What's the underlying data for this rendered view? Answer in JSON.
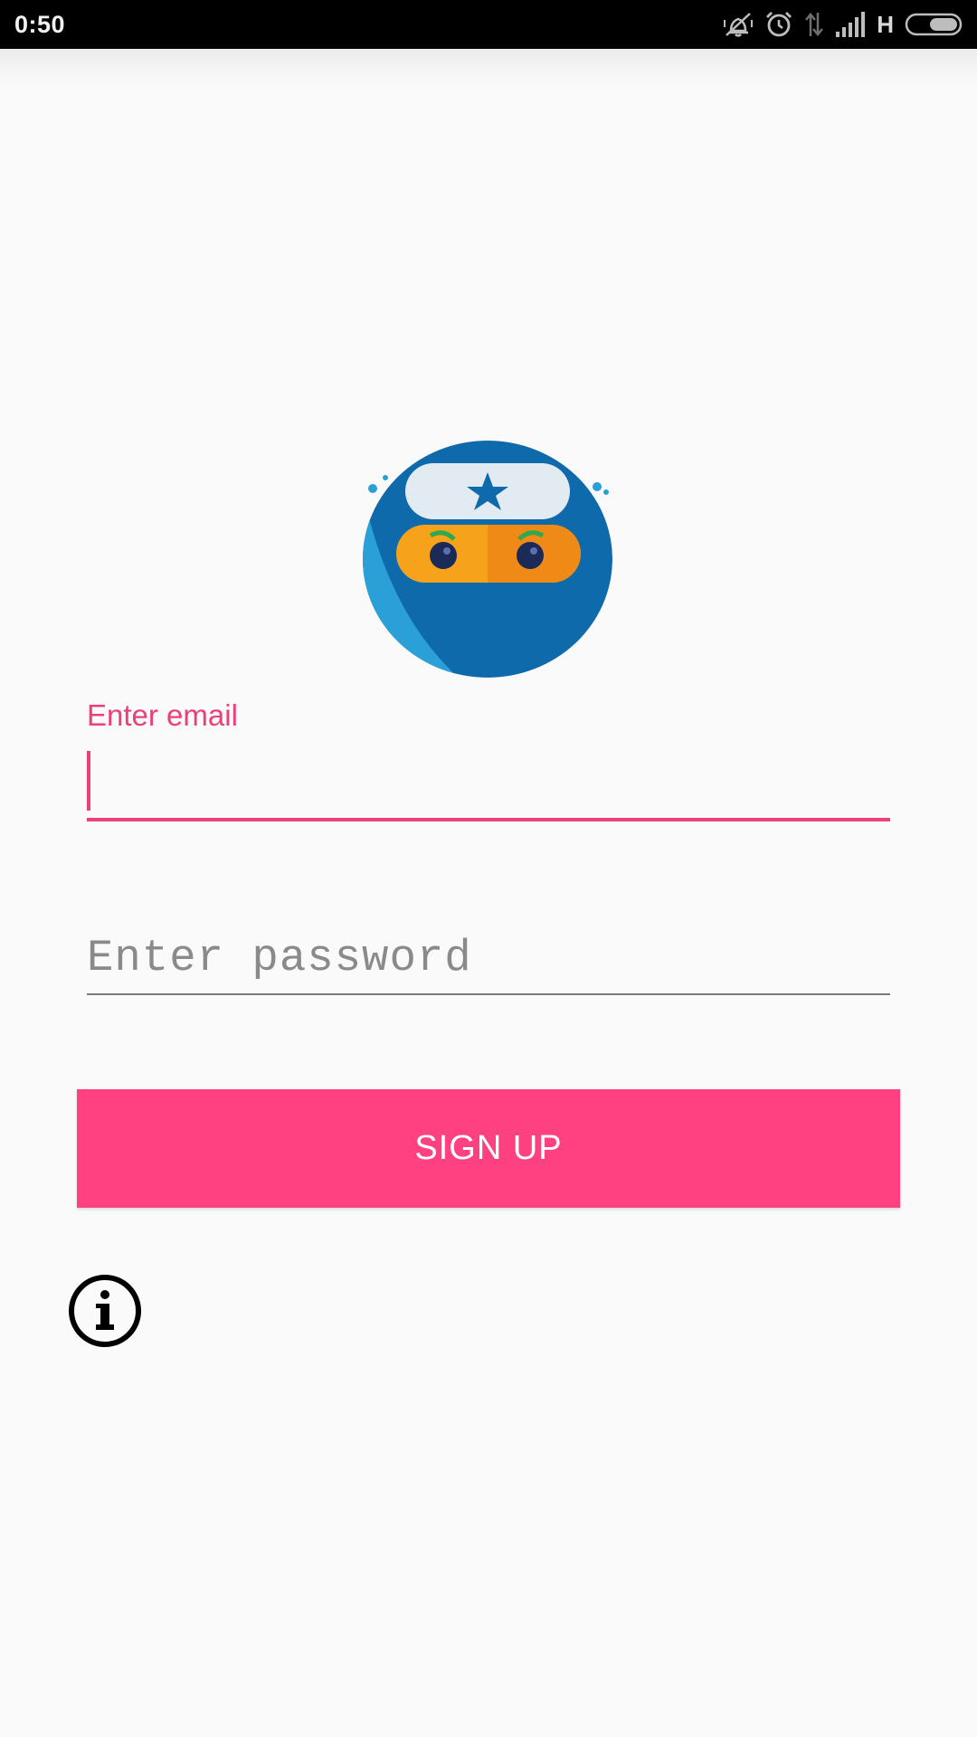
{
  "status_bar": {
    "time": "0:50",
    "network_type": "H",
    "icons": [
      "vibrate-off-icon",
      "alarm-icon",
      "data-transfer-icon",
      "signal-icon",
      "battery-icon"
    ]
  },
  "logo": {
    "icon": "ninja-logo-icon",
    "colors": {
      "body": "#0f6aac",
      "light_side": "#2a9fd8",
      "headband": "#e3ebf2",
      "mask": "#f7a21b"
    }
  },
  "form": {
    "email_label": "Enter email",
    "email_value": "",
    "password_placeholder": "Enter password",
    "password_value": ""
  },
  "signup_button": {
    "label": "SIGN UP"
  },
  "info": {
    "icon": "info-icon"
  },
  "colors": {
    "accent": "#ff4081",
    "accent_text": "#ec407a",
    "background": "#fafafa",
    "status_bar": "#000000"
  }
}
